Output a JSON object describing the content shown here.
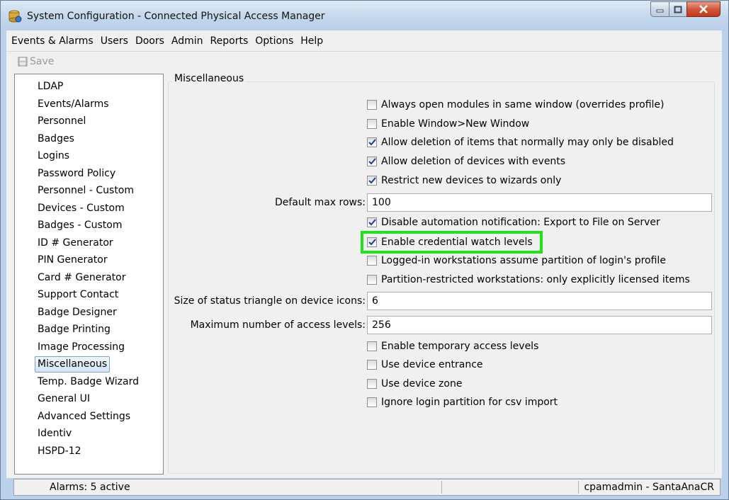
{
  "window": {
    "title": "System Configuration - Connected Physical Access Manager"
  },
  "menu": [
    "Events & Alarms",
    "Users",
    "Doors",
    "Admin",
    "Reports",
    "Options",
    "Help"
  ],
  "toolbar": {
    "save_label": "Save"
  },
  "nav": {
    "items": [
      "LDAP",
      "Events/Alarms",
      "Personnel",
      "Badges",
      "Logins",
      "Password Policy",
      "Personnel - Custom",
      "Devices - Custom",
      "Badges - Custom",
      "ID # Generator",
      "PIN Generator",
      "Card # Generator",
      "Support Contact",
      "Badge Designer",
      "Badge Printing",
      "Image Processing",
      "Miscellaneous",
      "Temp. Badge Wizard",
      "General UI",
      "Advanced Settings",
      "Identiv",
      "HSPD-12"
    ],
    "selected": "Miscellaneous"
  },
  "misc": {
    "group_title": "Miscellaneous",
    "checks1": [
      {
        "label": "Always open modules in same window (overrides profile)",
        "checked": false
      },
      {
        "label": "Enable Window>New Window",
        "checked": false
      },
      {
        "label": "Allow deletion of items that normally may only be disabled",
        "checked": true
      },
      {
        "label": "Allow deletion of devices with events",
        "checked": true
      },
      {
        "label": "Restrict new devices to wizards only",
        "checked": true
      }
    ],
    "max_rows_label": "Default max rows:",
    "max_rows_value": "100",
    "checks2": [
      {
        "label": "Disable automation notification: Export to File on Server",
        "checked": true
      },
      {
        "label": "Enable credential watch levels",
        "checked": true
      },
      {
        "label": "Logged-in workstations assume partition of login's profile",
        "checked": false
      },
      {
        "label": "Partition-restricted workstations: only explicitly licensed items",
        "checked": false
      }
    ],
    "triangle_label": "Size of status triangle on device icons:",
    "triangle_value": "6",
    "access_levels_label": "Maximum number of access levels:",
    "access_levels_value": "256",
    "checks3": [
      {
        "label": "Enable temporary access levels",
        "checked": false
      },
      {
        "label": "Use device entrance",
        "checked": false
      },
      {
        "label": "Use device zone",
        "checked": false
      },
      {
        "label": "Ignore login partition for csv import",
        "checked": false
      }
    ]
  },
  "status": {
    "alarms": "Alarms: 5 active",
    "middle": "",
    "user": "cpamadmin - SantaAnaCR"
  },
  "colors": {
    "highlight": "#22e01a",
    "check_mark": "#1c3f94",
    "title_bar": "#c4d7ec"
  }
}
